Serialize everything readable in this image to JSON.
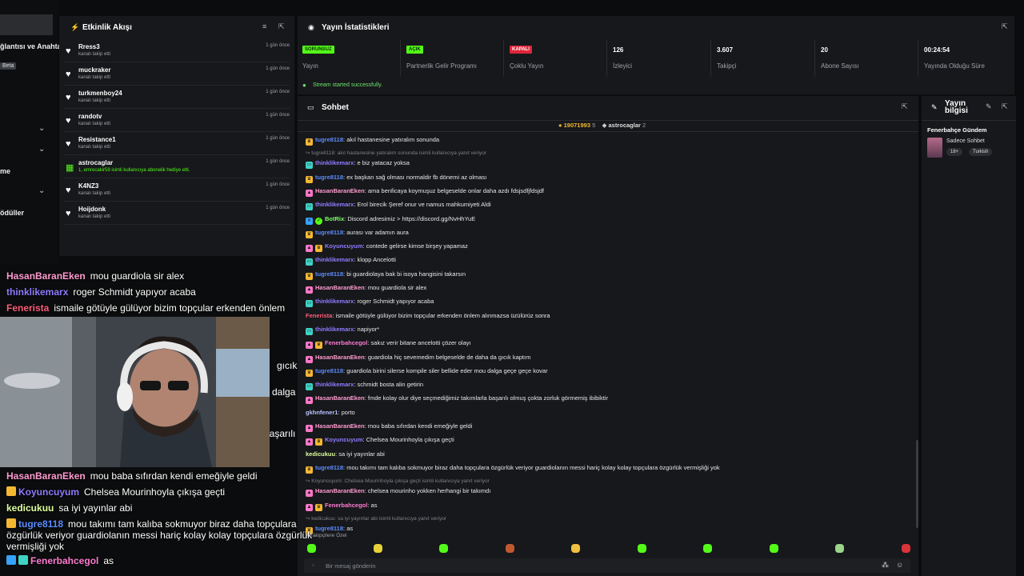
{
  "left": {
    "lines": [
      "ğlantısı ve Anahta",
      "me",
      "ödüller"
    ],
    "beta": "Beta"
  },
  "activity": {
    "title": "Etkinlik Akışı",
    "items": [
      {
        "name": "Rress3",
        "sub": "kanalı takip etti",
        "time": "1 gün önce"
      },
      {
        "name": "muckraker",
        "sub": "kanalı takip etti",
        "time": "1 gün önce"
      },
      {
        "name": "turkmenboy24",
        "sub": "kanalı takip etti",
        "time": "1 gün önce"
      },
      {
        "name": "randotv",
        "sub": "kanalı takip etti",
        "time": "1 gün önce"
      },
      {
        "name": "Resistance1",
        "sub": "kanalı takip etti",
        "time": "1 gün önce"
      },
      {
        "name": "astrocaglar",
        "sub": "1, emrecakir59 isimli kullanıcıya abonelik hediye etti.",
        "time": "1 gün önce"
      },
      {
        "name": "K4NZ3",
        "sub": "kanalı takip etti",
        "time": "1 gün önce"
      },
      {
        "name": "Hoijdonk",
        "sub": "kanalı takip etti",
        "time": "1 gün önce"
      }
    ]
  },
  "stats": {
    "title": "Yayın İstatistikleri",
    "items": [
      {
        "badge": "SORUNSUZ",
        "label": "Yayın"
      },
      {
        "badge": "AÇIK",
        "label": "Partnerlik Gelir Programı"
      },
      {
        "badge": "KAPALI",
        "label": "Çoklu Yayın"
      },
      {
        "value": "126",
        "label": "İzleyici"
      },
      {
        "value": "3.607",
        "label": "Takipçi"
      },
      {
        "value": "20",
        "label": "Abone Sayısı"
      },
      {
        "value": "00:24:54",
        "label": "Yayında Olduğu Süre"
      }
    ],
    "status_msg": "Stream started successfully."
  },
  "chat": {
    "title": "Sohbet",
    "top_gifters": [
      {
        "name": "19071993",
        "count": "5"
      },
      {
        "name": "astrocaglar",
        "count": "2"
      }
    ],
    "messages": [
      {
        "user": "tugre8118",
        "text": "akıl hastanesine yatıralım sonunda",
        "color": "#5b8cff",
        "icon": "crown"
      },
      {
        "reply": "tugre8118: akıl hastanesine yatıralım sonunda isimli kullanıcıya yanıt veriyor"
      },
      {
        "user": "thinklikemarx",
        "text": "e biz yatacaz yoksa",
        "color": "#8f7bff",
        "icon": "chat"
      },
      {
        "user": "tugre8118",
        "text": "ex başkan sağ olması normaldir fb dönemi az olması",
        "color": "#5b8cff",
        "icon": "crown"
      },
      {
        "user": "HasanBaranEken",
        "text": "ama benficaya koymuşuz belgeselde onlar daha azdı fdsjsdfjfdsjdf",
        "color": "#ff9bd0",
        "icon": "pink"
      },
      {
        "user": "thinklikemarx",
        "text": "Erol birecik Şeref onur ve namus mahkumiyeti Aldi",
        "color": "#8f7bff",
        "icon": "chat"
      },
      {
        "user": "BotRix",
        "text": "Discord adresimiz > https://discord.gg/NvHhYuE",
        "color": "#7cff6b",
        "icon": "bot"
      },
      {
        "user": "tugre8118",
        "text": "aurası var adamın aura",
        "color": "#5b8cff",
        "icon": "crown"
      },
      {
        "user": "Koyuncuyum",
        "text": "contede gelirse kimse birşey yapamaz",
        "color": "#8f7bff",
        "icon": "pink"
      },
      {
        "user": "thinklikemarx",
        "text": "klopp Ancelotti",
        "color": "#8f7bff",
        "icon": "chat"
      },
      {
        "user": "tugre8118",
        "text": "bi guardiolaya bak bi isoya hangisini takarsın",
        "color": "#5b8cff",
        "icon": "crown"
      },
      {
        "user": "HasanBaranEken",
        "text": "mou guardiola sir alex",
        "color": "#ff9bd0",
        "icon": "pink"
      },
      {
        "user": "thinklikemarx",
        "text": "roger Schmidt yapıyor acaba",
        "color": "#8f7bff",
        "icon": "chat"
      },
      {
        "user": "Fenerista",
        "text": "ismaile götüyle gülüyor bizim topçular erkenden önlem alınmazsa üzülürüz sonra",
        "color": "#ff5d7a",
        "icon": ""
      },
      {
        "user": "thinklikemarx",
        "text": "napiyor*",
        "color": "#8f7bff",
        "icon": "chat"
      },
      {
        "user": "Fenerbahcegol",
        "text": "sakız verir bitane ancelotti çözer olayı",
        "color": "#ff7bd3",
        "icon": "pink"
      },
      {
        "user": "HasanBaranEken",
        "text": "guardiola hiç sevemedim belgeselde de daha da gıcık kaptım",
        "color": "#ff9bd0",
        "icon": "pink"
      },
      {
        "user": "tugre8118",
        "text": "guardiola birini silerse kompile siler bellide eder mou dalga geçe geçe kovar",
        "color": "#5b8cff",
        "icon": "crown"
      },
      {
        "user": "thinklikemarx",
        "text": "schmidt bosta alin getirin",
        "color": "#8f7bff",
        "icon": "chat"
      },
      {
        "user": "HasanBaranEken",
        "text": "fmde kolay olur diye seçmediğimiz takımlarla başarılı olmuş çokta zorluk görmemiş ibibiktir",
        "color": "#ff9bd0",
        "icon": "pink"
      },
      {
        "user": "gkhnfener1",
        "text": "porto",
        "color": "#b9c0ff",
        "icon": ""
      },
      {
        "user": "HasanBaranEken",
        "text": "mou baba sıfırdan kendi emeğiyle geldi",
        "color": "#ff9bd0",
        "icon": "pink"
      },
      {
        "user": "Koyuncuyum",
        "text": "Chelsea Mourinhoyla çıkışa geçti",
        "color": "#8f7bff",
        "icon": "pink"
      },
      {
        "user": "kedicukuu",
        "text": "sa iyi yayınlar abi",
        "color": "#dfff9e",
        "icon": ""
      },
      {
        "user": "tugre8118",
        "text": "mou takımı tam kalıba sokmuyor biraz daha topçulara özgürlük veriyor guardiolanın messi hariç kolay kolay topçulara özgürlük vermişliği yok",
        "color": "#5b8cff",
        "icon": "crown"
      },
      {
        "reply": "Koyuncuyum: Chelsea Mourinhoyla çıkışa geçti isimli kullanıcıya yanıt veriyor"
      },
      {
        "user": "HasanBaranEken",
        "text": "chelsea mourinho yokken herhangi bir takımdı",
        "color": "#ff9bd0",
        "icon": "pink"
      },
      {
        "user": "Fenerbahcegol",
        "text": "as",
        "color": "#ff7bd3",
        "icon": "pink"
      },
      {
        "reply": "kedicukuu: sa iyi yayınlar abi isimli kullanıcıya yanıt veriyor"
      },
      {
        "user": "tugre8118",
        "text": "as",
        "color": "#5b8cff",
        "icon": "crown"
      }
    ],
    "followers_only": "Takipçilere Özel",
    "input_placeholder": "Bir mesaj gönderin"
  },
  "info": {
    "title": "Yayın bilgisi",
    "stream_title": "Fenerbahçe Gündem",
    "category": "Sadece Sohbet",
    "tags": [
      "18+",
      "Turkish"
    ]
  },
  "overlay": {
    "lines": [
      {
        "user": "HasanBaranEken",
        "text": "mou guardiola sir alex",
        "color": "#ff9bd0"
      },
      {
        "user": "thinklikemarx",
        "text": "roger Schmidt yapıyor acaba",
        "color": "#8f7bff"
      },
      {
        "user": "Fenerista",
        "text": "ismaile götüyle gülüyor bizim topçular erkenden önlem",
        "color": "#ff5d7a"
      },
      {
        "user": "HasanBaranEken",
        "text": "mou baba sıfırdan kendi emeğiyle geldi",
        "color": "#ff9bd0"
      },
      {
        "user": "Koyuncuyum",
        "text": "Chelsea Mourinhoyla çıkışa geçti",
        "color": "#8f7bff"
      },
      {
        "user": "kedicukuu",
        "text": "sa iyi yayınlar abi",
        "color": "#dfff9e"
      },
      {
        "user": "tugre8118",
        "text": "mou takımı tam kalıba sokmuyor biraz daha topçulara",
        "color": "#5b8cff"
      },
      {
        "user": "",
        "text": "özgürlük veriyor guardiolanın messi hariç kolay kolay topçulara özgürlük",
        "color": "#fff"
      },
      {
        "user": "",
        "text": "vermişliği yok",
        "color": "#fff"
      },
      {
        "user": "Fenerbahcegol",
        "text": "as",
        "color": "#ff7bd3"
      }
    ],
    "behind": [
      "gıcık",
      "dalga",
      "başarılı"
    ]
  }
}
